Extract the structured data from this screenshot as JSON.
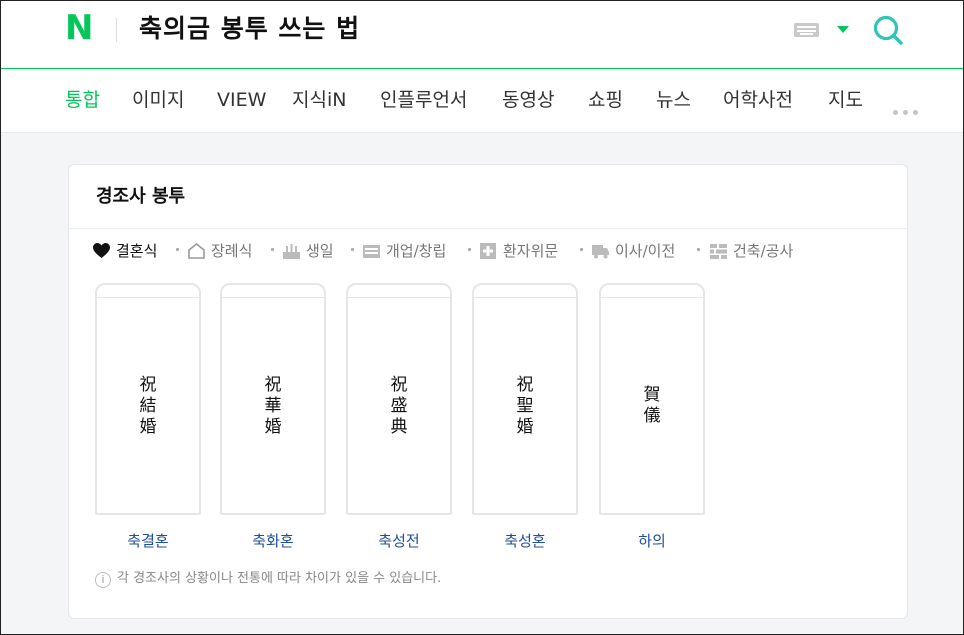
{
  "header": {
    "logo": "N",
    "query": "축의금 봉투 쓰는 법"
  },
  "tabs": [
    "통합",
    "이미지",
    "VIEW",
    "지식iN",
    "인플루언서",
    "동영상",
    "쇼핑",
    "뉴스",
    "어학사전",
    "지도"
  ],
  "card": {
    "title": "경조사 봉투",
    "categories": [
      {
        "label": "결혼식",
        "icon": "heart-icon"
      },
      {
        "label": "장례식",
        "icon": "house-icon"
      },
      {
        "label": "생일",
        "icon": "cake-icon"
      },
      {
        "label": "개업/창립",
        "icon": "store-icon"
      },
      {
        "label": "환자위문",
        "icon": "cross-icon"
      },
      {
        "label": "이사/이전",
        "icon": "truck-icon"
      },
      {
        "label": "건축/공사",
        "icon": "bricks-icon"
      }
    ],
    "envelopes": [
      {
        "chars": [
          "祝",
          "結",
          "婚"
        ],
        "label": "축결혼"
      },
      {
        "chars": [
          "祝",
          "華",
          "婚"
        ],
        "label": "축화혼"
      },
      {
        "chars": [
          "祝",
          "盛",
          "典"
        ],
        "label": "축성전"
      },
      {
        "chars": [
          "祝",
          "聖",
          "婚"
        ],
        "label": "축성혼"
      },
      {
        "chars": [
          "賀",
          "儀"
        ],
        "label": "하의"
      }
    ],
    "note": "각 경조사의 상황이나 전통에 따라 차이가 있을 수 있습니다."
  },
  "colors": {
    "brand": "#03c75a",
    "link": "#1f4fa0"
  }
}
